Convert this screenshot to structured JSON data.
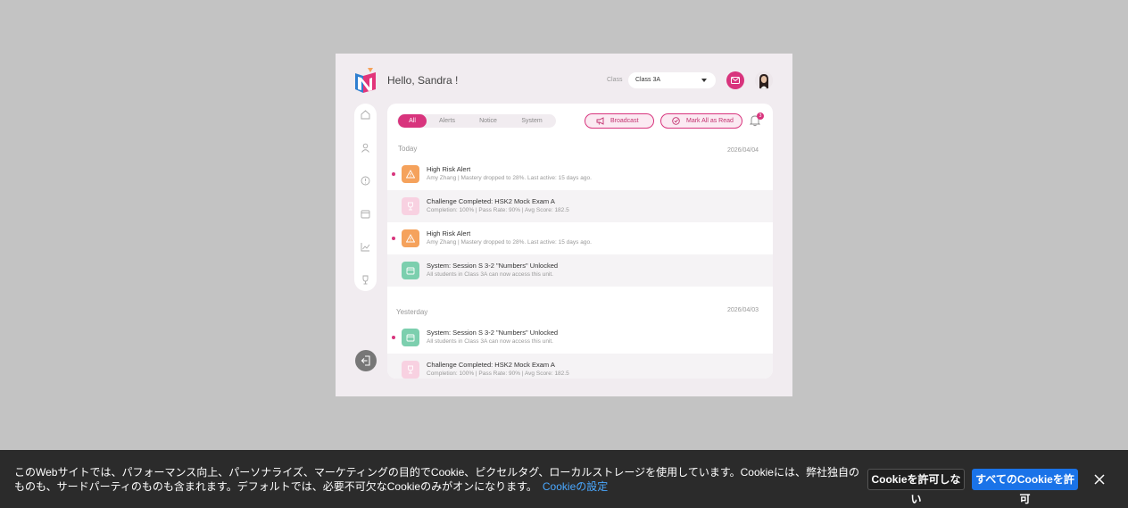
{
  "header": {
    "greeting": "Hello, Sandra !",
    "class_label": "Class",
    "class_value": "Class 3A"
  },
  "filters": {
    "tabs": [
      {
        "label": "All",
        "active": true
      },
      {
        "label": "Alerts",
        "active": false
      },
      {
        "label": "Notice",
        "active": false
      },
      {
        "label": "System",
        "active": false
      }
    ],
    "broadcast_label": "Broadcast",
    "mark_all_label": "Mark All as Read",
    "badge_count": "3"
  },
  "sections": {
    "today": {
      "label": "Today",
      "date": "2026/04/04",
      "items": [
        {
          "title": "High Risk Alert",
          "sub": "Amy Zhang | Mastery dropped to 28%. Last active: 15 days ago.",
          "icon": "warning-icon",
          "unread": true
        },
        {
          "title": "Challenge Completed: HSK2 Mock Exam A",
          "sub": "Completion: 100% | Pass Rate: 90% | Avg Score: 182.5",
          "icon": "trophy-icon",
          "unread": false
        },
        {
          "title": "High Risk Alert",
          "sub": "Amy Zhang | Mastery dropped to 28%. Last active: 15 days ago.",
          "icon": "warning-icon",
          "unread": true
        },
        {
          "title": "System: Session S 3-2 \"Numbers\" Unlocked",
          "sub": "All students in Class 3A can now access this unit.",
          "icon": "calendar-icon",
          "unread": false
        }
      ]
    },
    "yesterday": {
      "label": "Yesterday",
      "date": "2026/04/03",
      "items": [
        {
          "title": "System: Session S 3-2 \"Numbers\" Unlocked",
          "sub": "All students in Class 3A can now access this unit.",
          "icon": "calendar-icon",
          "unread": true
        },
        {
          "title": "Challenge Completed: HSK2 Mock Exam A",
          "sub": "Completion: 100% | Pass Rate: 90% | Avg Score: 182.5",
          "icon": "trophy-icon",
          "unread": false
        }
      ]
    }
  },
  "colors": {
    "accent": "#d8347d",
    "warning": "#f5a25c",
    "success": "#7ccfae"
  },
  "cookie": {
    "text": "このWebサイトでは、パフォーマンス向上、パーソナライズ、マーケティングの目的でCookie、ピクセルタグ、ローカルストレージを使用しています。Cookieには、弊社独自のものも、サードパーティのものも含まれます。デフォルトでは、必要不可欠なCookieのみがオンになります。",
    "settings_link": "Cookieの設定",
    "deny_label": "Cookieを許可しない",
    "accept_label": "すべてのCookieを許可"
  }
}
